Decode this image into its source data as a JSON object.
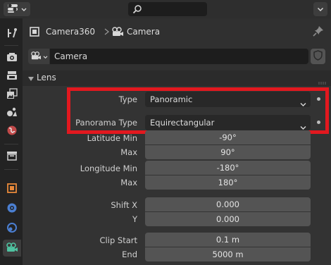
{
  "topbar": {
    "editor_icon": "properties-editor-icon",
    "search_icon": "search-icon",
    "collapse_icon": "chevron-down-icon"
  },
  "sidebar": {
    "tabs": [
      {
        "icon": "tool-icon"
      },
      {
        "icon": "render-icon"
      },
      {
        "icon": "output-icon"
      },
      {
        "icon": "view-layer-icon"
      },
      {
        "icon": "scene-icon"
      },
      {
        "icon": "world-icon"
      },
      {
        "icon": "collection-icon"
      },
      {
        "icon": "object-icon"
      },
      {
        "icon": "modifier-icon"
      },
      {
        "icon": "physics-icon"
      },
      {
        "icon": "camera-data-icon",
        "active": true
      }
    ]
  },
  "header": {
    "object_name": "Camera360",
    "data_name": "Camera"
  },
  "datablock": {
    "name": "Camera"
  },
  "panel": {
    "title": "Lens"
  },
  "fields": {
    "type_label": "Type",
    "type_value": "Panoramic",
    "pano_label": "Panorama Type",
    "pano_value": "Equirectangular",
    "lat_min_label": "Latitude Min",
    "lat_min_value": "-90°",
    "lat_max_label": "Max",
    "lat_max_value": "90°",
    "lon_min_label": "Longitude Min",
    "lon_min_value": "-180°",
    "lon_max_label": "Max",
    "lon_max_value": "180°",
    "shift_x_label": "Shift X",
    "shift_x_value": "0.000",
    "shift_y_label": "Y",
    "shift_y_value": "0.000",
    "clip_start_label": "Clip Start",
    "clip_start_value": "0.1 m",
    "clip_end_label": "End",
    "clip_end_value": "5000 m"
  },
  "colors": {
    "highlight": "#e2181f",
    "field_bg": "#545454",
    "dropdown_bg": "#282828",
    "accent_camera": "#4fc2a0"
  }
}
